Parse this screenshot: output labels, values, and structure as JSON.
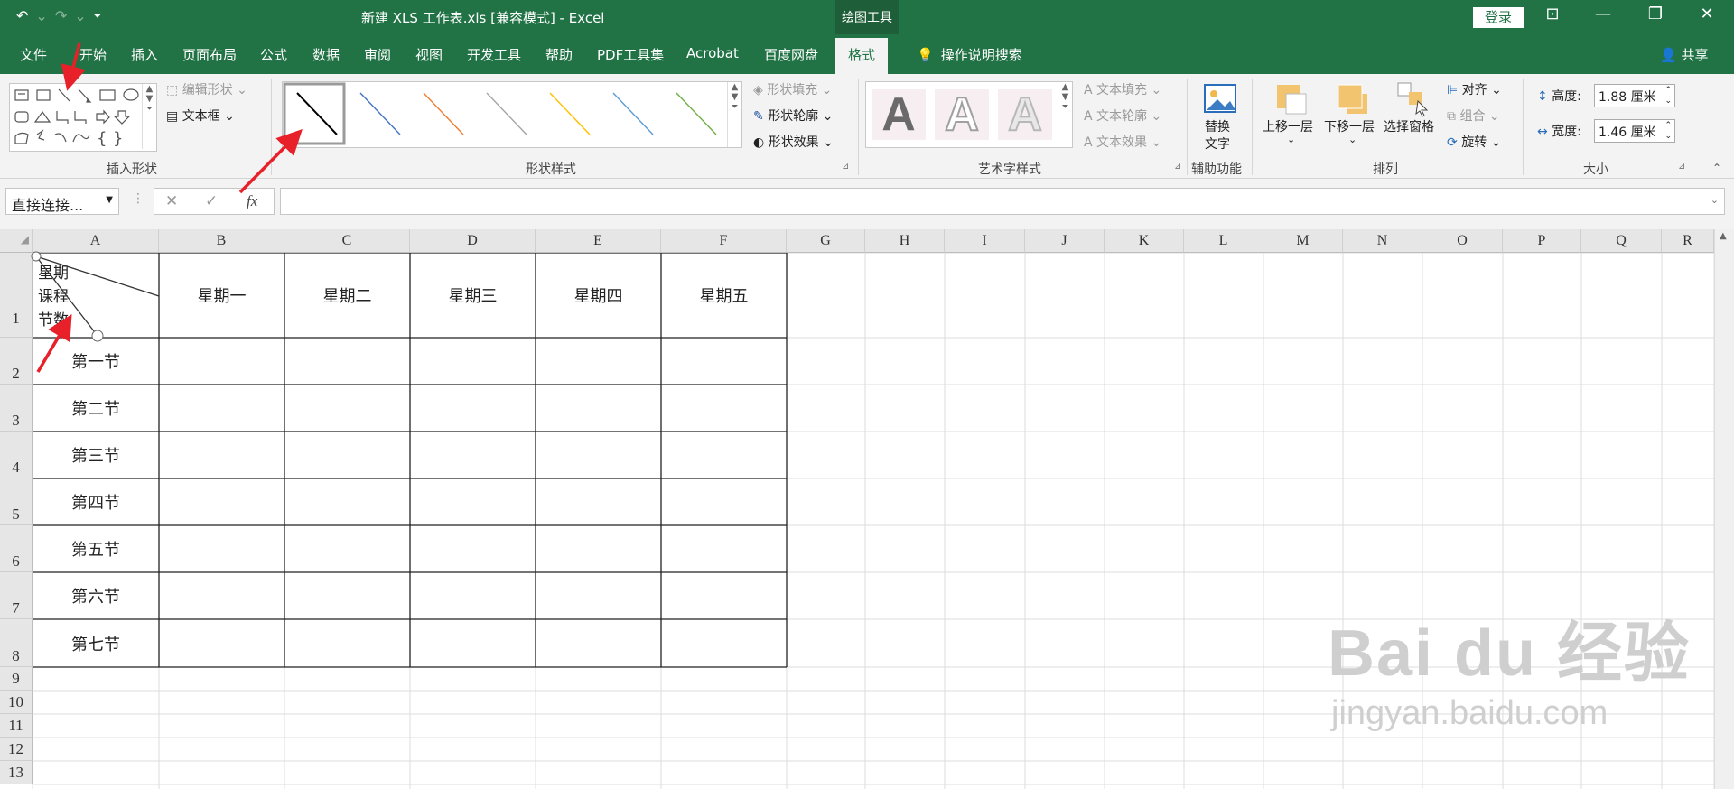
{
  "titlebar": {
    "title": "新建 XLS 工作表.xls  [兼容模式]  -  Excel",
    "context_tab": "绘图工具",
    "login": "登录",
    "qat": {
      "undo": "↶",
      "redo": "↷",
      "customize": "⏷"
    },
    "window_buttons": {
      "ribbon_display": "⊡",
      "minimize": "—",
      "restore": "❐",
      "close": "✕"
    }
  },
  "tabs": [
    "文件",
    "开始",
    "插入",
    "页面布局",
    "公式",
    "数据",
    "审阅",
    "视图",
    "开发工具",
    "帮助",
    "PDF工具集",
    "Acrobat",
    "百度网盘",
    "格式"
  ],
  "tell_me": "操作说明搜索",
  "share": "共享",
  "ribbon": {
    "insert_shapes": {
      "label": "插入形状",
      "edit_shape": "编辑形状",
      "text_box": "文本框"
    },
    "shape_styles": {
      "label": "形状样式",
      "fill": "形状填充",
      "outline": "形状轮廓",
      "effects": "形状效果"
    },
    "line_colors": [
      "#000000",
      "#4472c4",
      "#ed7d31",
      "#a5a5a5",
      "#ffc000",
      "#5b9bd5",
      "#70ad47"
    ],
    "wordart": {
      "label": "艺术字样式",
      "text_fill": "文本填充",
      "text_outline": "文本轮廓",
      "text_effects": "文本效果",
      "sample": "A"
    },
    "accessibility": {
      "label": "辅助功能",
      "alt_text_1": "替换",
      "alt_text_2": "文字"
    },
    "arrange": {
      "label": "排列",
      "bring_forward": "上移一层",
      "send_backward": "下移一层",
      "selection_pane": "选择窗格",
      "align": "对齐",
      "group": "组合",
      "rotate": "旋转"
    },
    "size": {
      "label": "大小",
      "height_label": "高度:",
      "height_value": "1.88 厘米",
      "width_label": "宽度:",
      "width_value": "1.46 厘米"
    }
  },
  "formula_bar": {
    "name_box": "直接连接...",
    "cancel": "✕",
    "enter": "✓",
    "fx": "fx",
    "value": ""
  },
  "columns": [
    "A",
    "B",
    "C",
    "D",
    "E",
    "F",
    "G",
    "H",
    "I",
    "J",
    "K",
    "L",
    "M",
    "N",
    "O",
    "P",
    "Q",
    "R"
  ],
  "rows": [
    "1",
    "2",
    "3",
    "4",
    "5",
    "6",
    "7",
    "8",
    "9",
    "10",
    "11",
    "12",
    "13"
  ],
  "table": {
    "header_diag": {
      "top": "星期",
      "middle": "课程",
      "bottom": "节数"
    },
    "weekdays": [
      "星期一",
      "星期二",
      "星期三",
      "星期四",
      "星期五"
    ],
    "periods": [
      "第一节",
      "第二节",
      "第三节",
      "第四节",
      "第五节",
      "第六节",
      "第七节"
    ]
  },
  "watermark": {
    "brand": "Bai  du 经验",
    "url": "jingyan.baidu.com"
  },
  "colors": {
    "excel_green": "#217346",
    "annotation_arrow": "#e8202a"
  }
}
